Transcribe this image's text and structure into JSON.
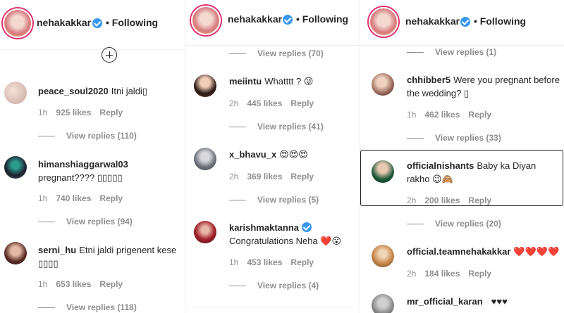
{
  "panels": [
    {
      "header": {
        "username": "nehakakkar",
        "following": "• Following"
      },
      "top_view_replies": "",
      "comments": [
        {
          "user": "peace_soul2020",
          "text": "Itni jaldi▯",
          "time": "1h",
          "likes": "925 likes",
          "reply": "Reply",
          "view_replies": "View replies (110)"
        },
        {
          "user": "himanshiaggarwal03",
          "text": "pregnant???? ▯▯▯▯▯",
          "time": "1h",
          "likes": "740 likes",
          "reply": "Reply",
          "view_replies": "View replies (94)"
        },
        {
          "user": "serni_hu",
          "text": "Etni jaldi prigenent kese ▯▯▯▯",
          "time": "1h",
          "likes": "653 likes",
          "reply": "Reply",
          "view_replies": "View replies (118)"
        }
      ]
    },
    {
      "header": {
        "username": "nehakakkar",
        "following": "• Following"
      },
      "top_view_replies": "View replies (70)",
      "comments": [
        {
          "user": "meiintu",
          "text": "Whatttt ? 😜",
          "time": "2h",
          "likes": "445 likes",
          "reply": "Reply",
          "view_replies": "View replies (41)"
        },
        {
          "user": "x_bhavu_x",
          "text": "😍😍😍",
          "time": "2h",
          "likes": "369 likes",
          "reply": "Reply",
          "view_replies": "View replies (5)"
        },
        {
          "user": "karishmaktanna",
          "text": "Congratulations Neha ❤️😮",
          "time": "1h",
          "likes": "453 likes",
          "reply": "Reply",
          "view_replies": "View replies (4)"
        }
      ]
    },
    {
      "header": {
        "username": "nehakakkar",
        "following": "• Following"
      },
      "top_view_replies": "View replies (1)",
      "comments": [
        {
          "user": "chhibber5",
          "text": "Were you pregnant before the wedding? ▯",
          "time": "1h",
          "likes": "462 likes",
          "reply": "Reply",
          "view_replies": "View replies (33)"
        },
        {
          "user": "officialnishants",
          "text": "Baby ka Diyan rakho 😉🙈",
          "time": "2h",
          "likes": "200 likes",
          "reply": "Reply",
          "view_replies": "View replies (20)"
        },
        {
          "user": "official.teamnehakakkar",
          "text": "❤️❤️❤️❤️",
          "time": "2h",
          "likes": "184 likes",
          "reply": "Reply",
          "view_replies": ""
        },
        {
          "user": "mr_official_karan",
          "text": "♥♥♥",
          "time": "",
          "likes": "",
          "reply": "",
          "view_replies": ""
        }
      ]
    }
  ],
  "colors": {
    "verified": "#3897f0",
    "muted": "#8e8e8e",
    "text": "#262626",
    "heart": "#c0202a"
  },
  "icons": [
    "verified-badge-icon",
    "add-comment-icon"
  ]
}
